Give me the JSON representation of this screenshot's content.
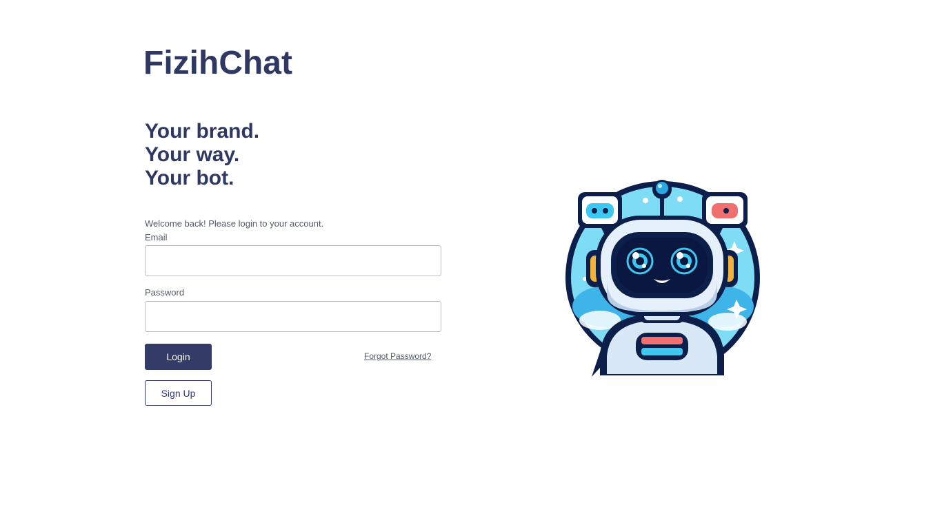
{
  "app": {
    "brand": "FizihChat"
  },
  "hero": {
    "lines": [
      "Your brand.",
      "Your way.",
      "Your bot."
    ]
  },
  "login_form": {
    "welcome_text": "Welcome back! Please login to your account.",
    "email_label": "Email",
    "email_value": "",
    "email_placeholder": "",
    "password_label": "Password",
    "password_value": "",
    "password_placeholder": "",
    "login_button": "Login",
    "forgot_password_link": "Forgot Password?",
    "signup_button": "Sign Up"
  },
  "illustration": {
    "icon": "robot-mascot-icon"
  },
  "colors": {
    "primary": "#333c66",
    "heading": "#2f3863",
    "signup_text": "#2a3a8a",
    "robot_visor": "#0c1f4a",
    "robot_accent": "#3cc8f0",
    "robot_red": "#f07070"
  }
}
